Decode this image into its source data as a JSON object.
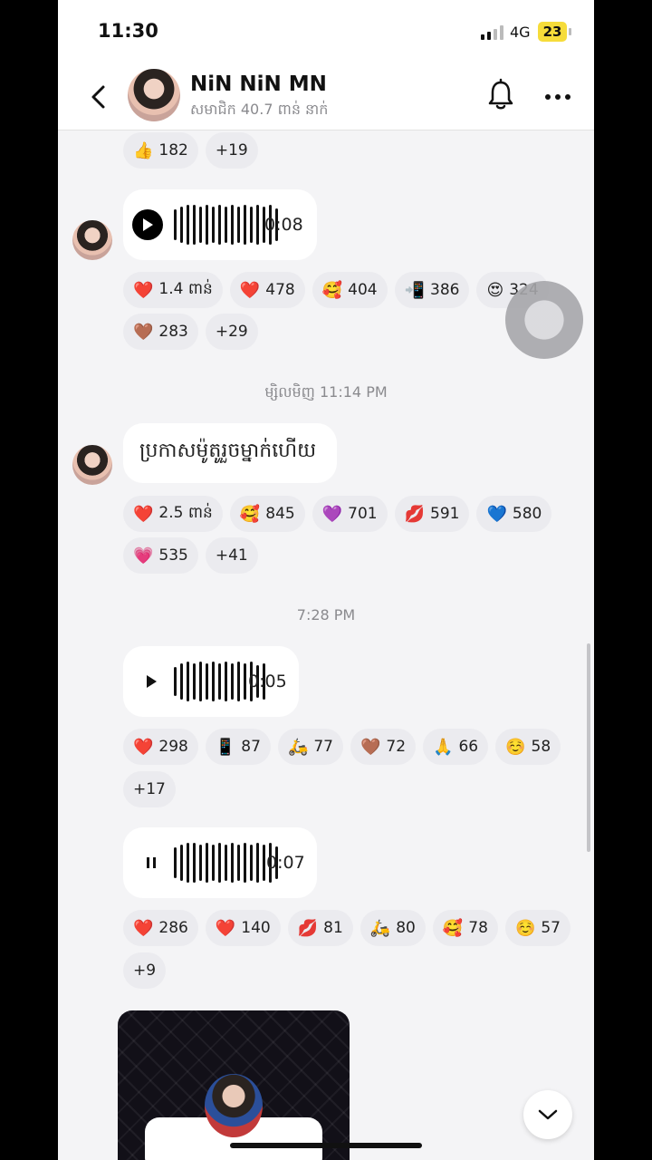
{
  "status": {
    "time": "11:30",
    "network": "4G",
    "battery": "23"
  },
  "header": {
    "name": "NiN NiN MN",
    "subtitle": "សមាជិក 40.7 ពាន់ នាក់"
  },
  "top_reactions": [
    {
      "emoji": "👍",
      "count": "182"
    },
    {
      "emoji": "",
      "count": "+19"
    }
  ],
  "voice1": {
    "duration": "0:08"
  },
  "voice1_reactions_row1": [
    {
      "emoji": "❤️",
      "count": "1.4 ពាន់"
    },
    {
      "emoji": "❤️",
      "count": "478"
    },
    {
      "emoji": "🥰",
      "count": "404"
    },
    {
      "emoji": "📲",
      "count": "386"
    },
    {
      "emoji": "😍",
      "count": "324"
    }
  ],
  "voice1_reactions_row2": [
    {
      "emoji": "🤎",
      "count": "283"
    },
    {
      "emoji": "",
      "count": "+29"
    }
  ],
  "stamp1": "ម្សិលមិញ 11:14 PM",
  "text_message": "ប្រកាសម៉ូតូរួចម្នាក់ហើយ",
  "text_reactions_row1": [
    {
      "emoji": "❤️",
      "count": "2.5 ពាន់"
    },
    {
      "emoji": "🥰",
      "count": "845"
    },
    {
      "emoji": "💜",
      "count": "701"
    },
    {
      "emoji": "💋",
      "count": "591"
    },
    {
      "emoji": "💙",
      "count": "580"
    }
  ],
  "text_reactions_row2": [
    {
      "emoji": "💗",
      "count": "535"
    },
    {
      "emoji": "",
      "count": "+41"
    }
  ],
  "stamp2": "7:28 PM",
  "voice2": {
    "duration": "0:05"
  },
  "voice2_reactions_row1": [
    {
      "emoji": "❤️",
      "count": "298"
    },
    {
      "emoji": "📱",
      "count": "87"
    },
    {
      "emoji": "🛵",
      "count": "77"
    },
    {
      "emoji": "🤎",
      "count": "72"
    },
    {
      "emoji": "🙏",
      "count": "66"
    },
    {
      "emoji": "☺️",
      "count": "58"
    }
  ],
  "voice2_reactions_row2": [
    {
      "emoji": "",
      "count": "+17"
    }
  ],
  "voice3": {
    "duration": "0:07"
  },
  "voice3_reactions_row1": [
    {
      "emoji": "❤️",
      "count": "286"
    },
    {
      "emoji": "❤️",
      "count": "140"
    },
    {
      "emoji": "💋",
      "count": "81"
    },
    {
      "emoji": "🛵",
      "count": "80"
    },
    {
      "emoji": "🥰",
      "count": "78"
    },
    {
      "emoji": "☺️",
      "count": "57"
    }
  ],
  "voice3_reactions_row2": [
    {
      "emoji": "",
      "count": "+9"
    }
  ],
  "icons": {
    "back": "chevron-left-icon",
    "bell": "bell-icon",
    "more": "more-horizontal-icon",
    "play": "play-icon",
    "pause": "pause-icon",
    "scroll_down": "chevron-down-icon"
  }
}
